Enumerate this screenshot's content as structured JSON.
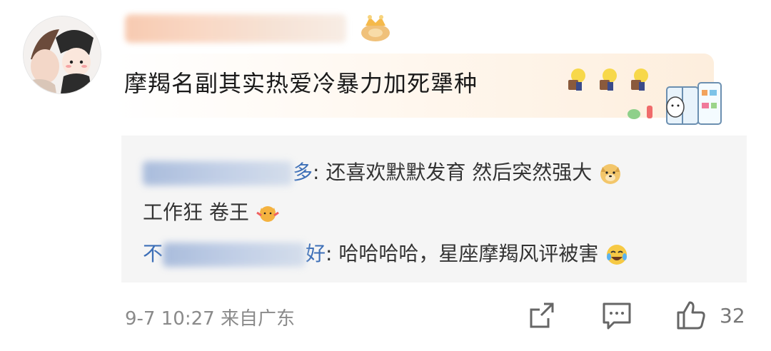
{
  "comment": {
    "avatar_alt": "user-avatar",
    "text": "摩羯名副其实热爱冷暴力加死犟种"
  },
  "replies": [
    {
      "name_visible_tail": "多",
      "text_line1": ": 还喜欢默默发育 然后突然强大",
      "text_line2": "工作狂 卷王"
    },
    {
      "name_visible_head": "不",
      "name_visible_tail": "好",
      "text": ": 哈哈哈哈，星座摩羯风评被害"
    }
  ],
  "footer": {
    "date": "9-7",
    "time": "10:27",
    "location": "来自广东",
    "like_count": "32"
  },
  "colors": {
    "reply_bg": "#f5f5f5",
    "name_link": "#3d6fb7",
    "meta_gray": "#8a8a8a"
  }
}
